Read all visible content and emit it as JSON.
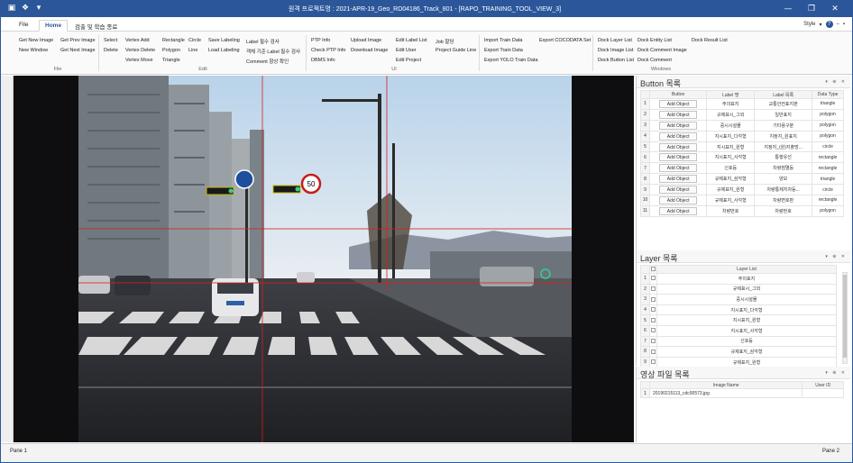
{
  "window": {
    "title": "원격 프로젝트명 : 2021-APR-19_Geo_RD04186_Track_801 - [RAPO_TRAINING_TOOL_VIEW_3]",
    "minimize": "—",
    "maximize": "❐",
    "close": "✕"
  },
  "qat": {
    "save": "▣",
    "logo": "❖",
    "arrow": "▾"
  },
  "tabs": [
    "File",
    "Home",
    "검출 및 학습 종료"
  ],
  "style_label": "Style",
  "ribbon": {
    "file_items": [
      "Get New Image",
      "Get Prev Image",
      "New Window",
      "Get Next Image"
    ],
    "file_group": "File",
    "edit_items": {
      "select": "Select",
      "delete": "Delete",
      "vertex_add": "Vertex Add",
      "vertex_delete": "Vertex Delete",
      "vertex_move": "Vertex Move",
      "rectangle": "Rectangle",
      "polygon": "Polygon",
      "triangle": "Triangle",
      "circle": "Circle",
      "line": "Line",
      "save_labeling": "Save Labeling",
      "load_labeling": "Load Labeling",
      "label_err_check": "Label 필수 검사",
      "label_rule_check": "객체 기준 Label 필수 검사",
      "comment_check": "Comment 항상 확인"
    },
    "edit_group": "Edit",
    "gps_items": [
      "PTP Info",
      "Check PTP Info",
      "DBMS Info"
    ],
    "upload_items": [
      "Upload Image",
      "Download Image"
    ],
    "label_items": [
      "Edit Label List",
      "Edit User",
      "Edit Project"
    ],
    "job_items": [
      "Job 할당",
      "Project Guide Line"
    ],
    "ui_group": "UI",
    "export_items": [
      "Import Train Data",
      "Export Train Data",
      "Export YOLO Train Data"
    ],
    "coco": "Export COCODATA Set",
    "window_items": [
      "Dock Layer List",
      "Dock Entity List",
      "Dock Result List",
      "Dock Image List",
      "Dock Comment Image",
      "Dock Button List",
      "Dock Comment"
    ],
    "window_group": "Windows"
  },
  "button_panel": {
    "title": "Button 목록",
    "headers": [
      "Button",
      "Label 명",
      "Label 목록",
      "Data Type"
    ],
    "add_label": "Add Object",
    "rows": [
      {
        "idx": "1",
        "label": "주의표지",
        "list": "교통안전표지판",
        "type": "triangle"
      },
      {
        "idx": "2",
        "label": "규제표시_그외",
        "list": "일반표지",
        "type": "polygon"
      },
      {
        "idx": "3",
        "label": "중시시설물",
        "list": "기타용구분",
        "type": "polygon"
      },
      {
        "idx": "4",
        "label": "지시표지_다각형",
        "list": "지정지_원표지",
        "type": "polygon"
      },
      {
        "idx": "5",
        "label": "지시표지_원형",
        "list": "지정지_(원)지출방...",
        "type": "circle"
      },
      {
        "idx": "6",
        "label": "지시표지_사각형",
        "list": "통행유선",
        "type": "rectangle"
      },
      {
        "idx": "7",
        "label": "신호등",
        "list": "차량점멸등",
        "type": "rectangle"
      },
      {
        "idx": "8",
        "label": "규제표지_삼각형",
        "list": "양보",
        "type": "triangle"
      },
      {
        "idx": "9",
        "label": "규제표지_원형",
        "list": "차량통제지차등...",
        "type": "circle"
      },
      {
        "idx": "10",
        "label": "규제표지_사각형",
        "list": "차량변호판",
        "type": "rectangle"
      },
      {
        "idx": "11",
        "label": "차량번호",
        "list": "차량번호",
        "type": "polygon"
      }
    ]
  },
  "layer_panel": {
    "title": "Layer 목록",
    "header": "Layer List",
    "rows": [
      {
        "idx": "1",
        "name": "주의표지"
      },
      {
        "idx": "2",
        "name": "규제표시_그외"
      },
      {
        "idx": "3",
        "name": "중시시설물"
      },
      {
        "idx": "4",
        "name": "지시표지_다각형"
      },
      {
        "idx": "5",
        "name": "지시표지_원형"
      },
      {
        "idx": "6",
        "name": "지시표지_사각형"
      },
      {
        "idx": "7",
        "name": "신호등"
      },
      {
        "idx": "8",
        "name": "규제표지_삼각형"
      },
      {
        "idx": "9",
        "name": "규제표지_원형"
      }
    ]
  },
  "image_panel": {
    "title": "영상 파일 목록",
    "headers": [
      "Image Name",
      "User ID"
    ],
    "rows": [
      {
        "idx": "1",
        "name": "20190215113_cdc00573.jpg",
        "user": ""
      }
    ]
  },
  "status": {
    "left": "Pane 1",
    "right": "Pane 2"
  }
}
